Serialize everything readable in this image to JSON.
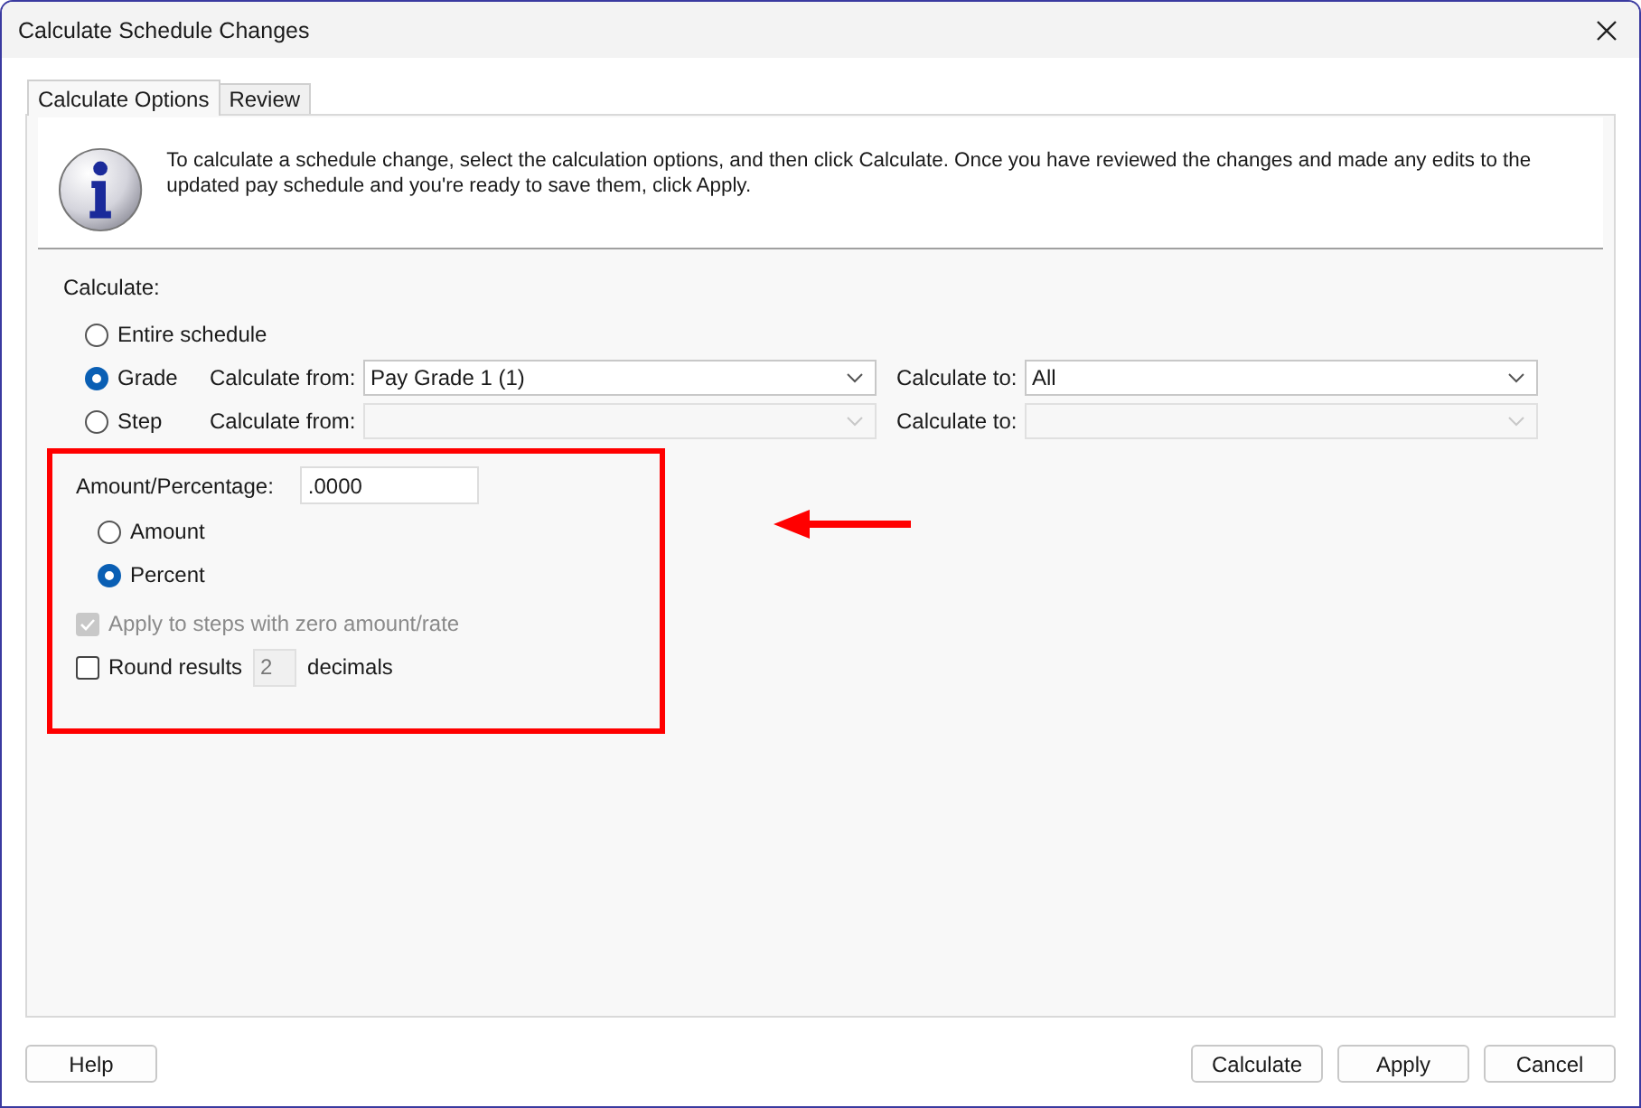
{
  "window": {
    "title": "Calculate Schedule Changes"
  },
  "tabs": [
    {
      "label": "Calculate Options",
      "selected": true
    },
    {
      "label": "Review",
      "selected": false
    }
  ],
  "info": {
    "message": "To calculate a schedule change, select the calculation options, and then click Calculate. Once you have reviewed the changes and made any edits to the updated pay schedule and you're ready to save them, click Apply."
  },
  "calculate": {
    "label": "Calculate:",
    "options": [
      {
        "label": "Entire schedule",
        "selected": false
      },
      {
        "label": "Grade",
        "selected": true,
        "disabled": false,
        "from_label": "Calculate from:",
        "from_value": "Pay Grade 1 (1)",
        "to_label": "Calculate to:",
        "to_value": "All"
      },
      {
        "label": "Step",
        "selected": false,
        "disabled": true,
        "from_label": "Calculate from:",
        "to_label": "Calculate to:"
      }
    ]
  },
  "amount": {
    "label": "Amount/Percentage:",
    "value": ".0000",
    "options": [
      {
        "label": "Amount",
        "selected": false
      },
      {
        "label": "Percent",
        "selected": true
      }
    ]
  },
  "apply_zero": {
    "label": "Apply to steps with zero amount/rate",
    "checked": true,
    "disabled": true
  },
  "round": {
    "label": "Round results",
    "checked": false,
    "value": "2",
    "value_disabled": true,
    "suffix": "decimals"
  },
  "buttons": {
    "left": [
      "Help"
    ],
    "right": [
      "Calculate",
      "Apply",
      "Cancel"
    ]
  }
}
